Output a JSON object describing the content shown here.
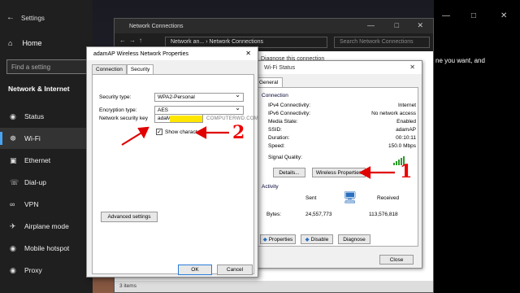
{
  "settings": {
    "title": "Settings",
    "home": "Home",
    "search_placeholder": "Find a setting",
    "section": "Network & Internet",
    "items": [
      {
        "label": "Status",
        "icon": "globe-icon"
      },
      {
        "label": "Wi-Fi",
        "icon": "wifi-icon"
      },
      {
        "label": "Ethernet",
        "icon": "ethernet-icon"
      },
      {
        "label": "Dial-up",
        "icon": "phone-icon"
      },
      {
        "label": "VPN",
        "icon": "vpn-icon"
      },
      {
        "label": "Airplane mode",
        "icon": "airplane-icon"
      },
      {
        "label": "Mobile hotspot",
        "icon": "hotspot-icon"
      },
      {
        "label": "Proxy",
        "icon": "globe-icon"
      }
    ],
    "selected": "Wi-Fi"
  },
  "right_panel": {
    "text": "ne you want, and"
  },
  "network_connections": {
    "title": "Network Connections",
    "crumb1": "Network an...",
    "crumb2": "Network Connections",
    "search_placeholder": "Search Network Connections",
    "command": "Diagnose this connection",
    "status": "3 items"
  },
  "wifi_status": {
    "title": "Wi-Fi Status",
    "tab": "General",
    "connection_label": "Connection",
    "fields": [
      {
        "k": "IPv4 Connectivity:",
        "v": "Internet"
      },
      {
        "k": "IPv6 Connectivity:",
        "v": "No network access"
      },
      {
        "k": "Media State:",
        "v": "Enabled"
      },
      {
        "k": "SSID:",
        "v": "adamAP"
      },
      {
        "k": "Duration:",
        "v": "00:10:11"
      },
      {
        "k": "Speed:",
        "v": "150.0 Mbps"
      }
    ],
    "signal_label": "Signal Quality:",
    "details_btn": "Details...",
    "wireless_btn": "Wireless Properties",
    "activity_label": "Activity",
    "sent": "Sent",
    "received": "Received",
    "bytes_label": "Bytes:",
    "bytes_sent": "24,557,773",
    "bytes_received": "113,576,818",
    "properties_btn": "Properties",
    "disable_btn": "Disable",
    "diagnose_btn": "Diagnose",
    "close_btn": "Close"
  },
  "wireless_props": {
    "title": "adamAP Wireless Network Properties",
    "tabs": [
      "Connection",
      "Security"
    ],
    "security_type_label": "Security type:",
    "security_type": "WPA2-Personal",
    "encryption_label": "Encryption type:",
    "encryption": "AES",
    "key_label": "Network security key",
    "key_value": "adaM",
    "watermark": "COMPUTERWD.COM",
    "show_chars": "Show characters",
    "advanced_btn": "Advanced settings",
    "ok_btn": "OK",
    "cancel_btn": "Cancel"
  },
  "annotations": {
    "n1": "1",
    "n2": "2",
    "color": "#e00000"
  }
}
